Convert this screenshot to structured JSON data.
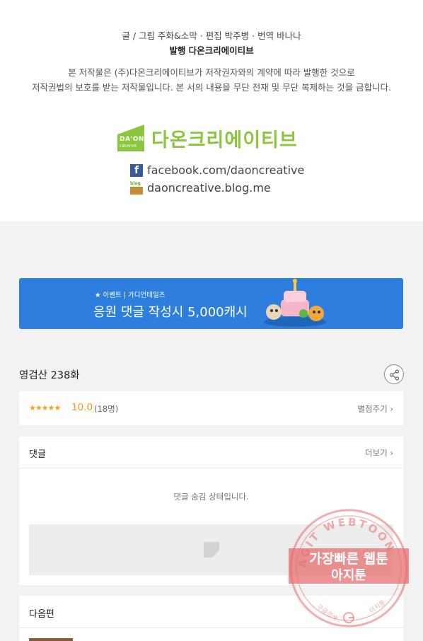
{
  "credits": {
    "line1": "글 / 그림 주화&소막 · 편집 박주병 · 번역 바나나",
    "line2": "발행 다온크리에이티브"
  },
  "notice": {
    "line1": "본 저작물은 (주)다온크리에이티브가 저작권자와의 계약에 따라 발행한 것으로",
    "line2": "저작권법의 보호를 받는 저작물입니다. 본 서의 내용을 무단 전재 및 무단 복제하는 것을 금합니다."
  },
  "publisher": {
    "logo_text": "DA'ON",
    "logo_sub": "CREATIVE",
    "name": "다온크리에이티브",
    "brand_color": "#8cc63f",
    "facebook": "facebook.com/daoncreative",
    "blog": "daoncreative.blog.me",
    "blog_icon_text": "blog"
  },
  "banner": {
    "tag": "★ 이벤트 | 가디언테일즈",
    "title": "응원 댓글 작성시 5,000캐시",
    "color": "#2e7fdd"
  },
  "episode": {
    "title": "영검산 238화"
  },
  "rating": {
    "stars": "★★★★★",
    "score": "10.0",
    "count": "(18명)",
    "rate_link": "별점주기 ›"
  },
  "comments": {
    "label": "댓글",
    "more": "더보기 ›",
    "hidden_message": "댓글 숨김 상태입니다."
  },
  "next": {
    "label": "다음편"
  },
  "watermark": {
    "arc_text": "AGIT WEBTOON",
    "line1": "가장빠른 웹툰",
    "line2": "아지툰",
    "bottom_left": "구글검색",
    "bottom_right": "아지툰"
  }
}
